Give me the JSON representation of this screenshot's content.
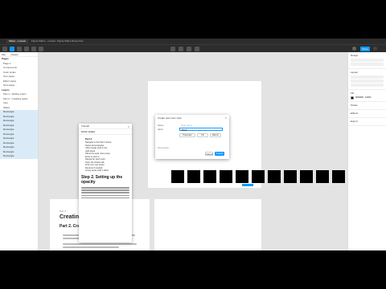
{
  "tabs": [
    "Slides – Lesson",
    "Figma Slides – Lesson",
    "Figma Slides Resources"
  ],
  "share_label": "Share",
  "left_panel": {
    "tabs": [
      "File",
      "Assets",
      "Layers"
    ],
    "rows": [
      {
        "label": "Pages",
        "kind": "head"
      },
      {
        "label": "Page 1",
        "kind": "row"
      },
      {
        "label": "Components",
        "kind": "row"
      },
      {
        "label": "Color styles",
        "kind": "row"
      },
      {
        "label": "Text styles",
        "kind": "row"
      },
      {
        "label": "Effect styles",
        "kind": "row"
      },
      {
        "label": "Grid styles",
        "kind": "row"
      },
      {
        "label": "Layers",
        "kind": "head"
      },
      {
        "label": "Part 1 - Adding colors",
        "kind": "row"
      },
      {
        "label": "Part 2 - Creating styles",
        "kind": "row"
      },
      {
        "label": "Intro",
        "kind": "row"
      },
      {
        "label": "Slides",
        "kind": "row"
      },
      {
        "label": "Rectangle",
        "kind": "sel"
      },
      {
        "label": "Rectangle",
        "kind": "sel"
      },
      {
        "label": "Rectangle",
        "kind": "sel"
      },
      {
        "label": "Rectangle",
        "kind": "sel"
      },
      {
        "label": "Rectangle",
        "kind": "sel"
      },
      {
        "label": "Rectangle",
        "kind": "sel"
      },
      {
        "label": "Rectangle",
        "kind": "sel"
      },
      {
        "label": "Rectangle",
        "kind": "sel"
      },
      {
        "label": "Rectangle",
        "kind": "sel"
      },
      {
        "label": "Rectangle",
        "kind": "sel"
      },
      {
        "label": "Rectangle",
        "kind": "sel"
      }
    ]
  },
  "right_panel": {
    "sections": [
      "Design",
      "Layout",
      "Fill",
      "Stroke",
      "Effects",
      "Export"
    ],
    "fill_value": "000000",
    "fill_opacity": "100%"
  },
  "plugin": {
    "title": "Tutorial",
    "subhead": "Color styles",
    "section": "Part 2",
    "lines": [
      "Navigate to the Part 2 frame.",
      "Select all rectangles.",
      "Click Create style in the",
      "right panel.",
      "Name the style, then press",
      "Enter to save it.",
      "Repeat for each color.",
      "Open the Assets tab.",
      "Find your new styles.",
      "Rename if needed.",
      "Group styles with a slash."
    ],
    "step_title": "Step 2. Setting up the opacity"
  },
  "modal": {
    "title": "Create new color style",
    "name_label": "Name",
    "name_placeholder": "Style name",
    "value_label": "Value",
    "value": "Black",
    "segments": [
      "Properties",
      "Fill",
      "Effects"
    ],
    "desc_label": "Description",
    "cancel_label": "Cancel",
    "create_label": "Create"
  },
  "bottom_frame": {
    "eyebrow": "Part 2",
    "title": "Creating color styles",
    "subtitle": "Part 2. Creating styles"
  },
  "help_label": "?"
}
